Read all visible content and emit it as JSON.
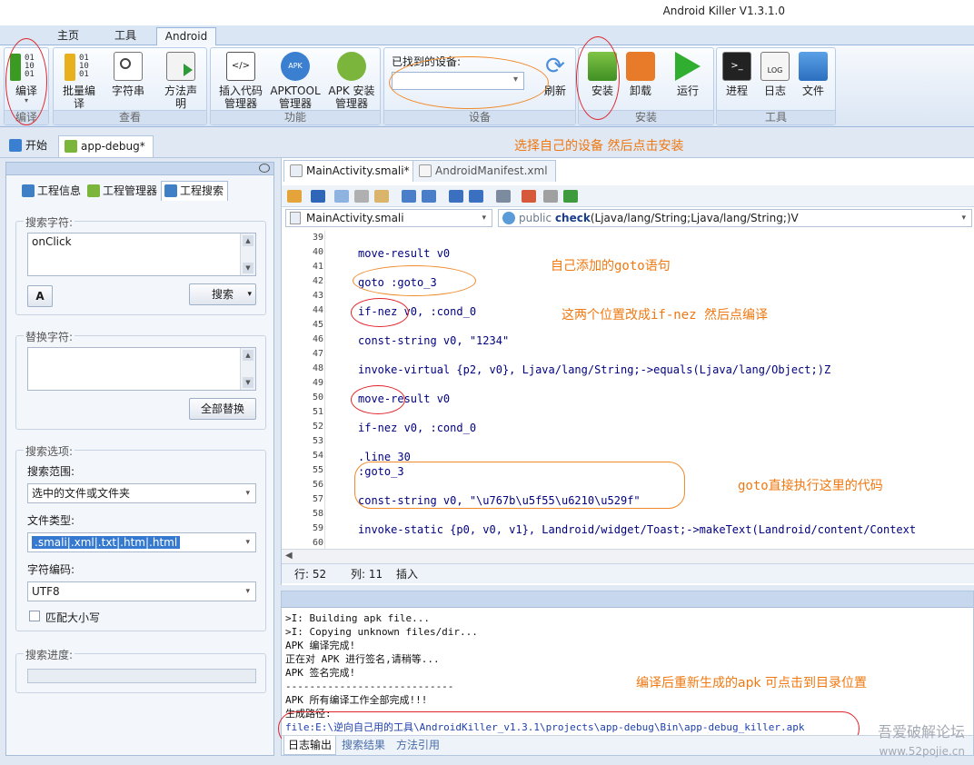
{
  "app": {
    "title": "Android Killer V1.3.1.0"
  },
  "ribbon": {
    "tabs": [
      {
        "label": "主页"
      },
      {
        "label": "工具"
      },
      {
        "label": "Android"
      }
    ],
    "groups": {
      "compile": {
        "label": "编译",
        "buttons": [
          {
            "label": "编译"
          }
        ]
      },
      "view": {
        "label": "查看",
        "buttons": [
          {
            "label": "批量编译"
          },
          {
            "label": "字符串"
          },
          {
            "label": "方法声明"
          }
        ]
      },
      "feature": {
        "label": "功能",
        "buttons": [
          {
            "label": "插入代码管理器"
          },
          {
            "label": "APKTOOL管理器"
          },
          {
            "label": "APK 安装管理器"
          }
        ]
      },
      "device": {
        "label": "设备",
        "found_label": "已找到的设备:",
        "refresh": "刷新"
      },
      "install": {
        "label": "安装",
        "buttons": [
          {
            "label": "安装"
          },
          {
            "label": "卸载"
          },
          {
            "label": "运行"
          }
        ]
      },
      "tools": {
        "label": "工具",
        "buttons": [
          {
            "label": "进程"
          },
          {
            "label": "日志"
          },
          {
            "label": "文件"
          }
        ]
      }
    }
  },
  "doc_tabs": {
    "start": "开始",
    "project": "app-debug*"
  },
  "annotations": {
    "select_device": "选择自己的设备 然后点击安装",
    "goto_added": "自己添加的goto语句",
    "change_ifnez": "这两个位置改成if-nez 然后点编译",
    "goto_exec": "goto直接执行这里的代码",
    "rebuilt_apk": "编译后重新生成的apk 可点击到目录位置"
  },
  "left_panel": {
    "tabs": [
      {
        "label": "工程信息"
      },
      {
        "label": "工程管理器"
      },
      {
        "label": "工程搜索"
      }
    ],
    "search": {
      "title": "搜索字符:",
      "value": "onClick",
      "button": "搜索",
      "font_icon": "A"
    },
    "replace": {
      "title": "替换字符:",
      "value": "",
      "button": "全部替换"
    },
    "options": {
      "title": "搜索选项:",
      "scope_label": "搜索范围:",
      "scope_value": "选中的文件或文件夹",
      "type_label": "文件类型:",
      "type_value": ".smali|.xml|.txt|.htm|.html",
      "enc_label": "字符编码:",
      "enc_value": "UTF8",
      "case_label": "匹配大小写"
    },
    "progress": {
      "title": "搜索进度:"
    }
  },
  "editor": {
    "tabs": [
      {
        "label": "MainActivity.smali*"
      },
      {
        "label": "AndroidManifest.xml"
      }
    ],
    "file_combo": "MainActivity.smali",
    "method_combo_kw": "public",
    "method_combo_name": "check",
    "method_combo_sig": "(Ljava/lang/String;Ljava/lang/String;)V",
    "lines": [
      {
        "n": "39",
        "text": ""
      },
      {
        "n": "40",
        "text": "move-result v0"
      },
      {
        "n": "41",
        "text": ""
      },
      {
        "n": "42",
        "text": "goto :goto_3"
      },
      {
        "n": "43",
        "text": ""
      },
      {
        "n": "44",
        "text": "if-nez v0, :cond_0"
      },
      {
        "n": "45",
        "text": ""
      },
      {
        "n": "46",
        "text": "const-string v0, \"1234\""
      },
      {
        "n": "47",
        "text": ""
      },
      {
        "n": "48",
        "text": "invoke-virtual {p2, v0}, Ljava/lang/String;->equals(Ljava/lang/Object;)Z"
      },
      {
        "n": "49",
        "text": ""
      },
      {
        "n": "50",
        "text": "move-result v0"
      },
      {
        "n": "51",
        "text": ""
      },
      {
        "n": "52",
        "text": "if-nez v0, :cond_0"
      },
      {
        "n": "53",
        "text": ""
      },
      {
        "n": "54",
        "text": ".line 30"
      },
      {
        "n": "55",
        "text": ":goto_3"
      },
      {
        "n": "56",
        "text": ""
      },
      {
        "n": "57",
        "text": "const-string v0, \"\\u767b\\u5f55\\u6210\\u529f\""
      },
      {
        "n": "58",
        "text": ""
      },
      {
        "n": "59",
        "text": "invoke-static {p0, v0, v1}, Landroid/widget/Toast;->makeText(Landroid/content/Context"
      },
      {
        "n": "60",
        "text": ""
      }
    ],
    "status": {
      "row": "行: 52",
      "col": "列: 11",
      "mode": "插入"
    }
  },
  "log": {
    "lines": [
      ">I: Building apk file...",
      ">I: Copying unknown files/dir...",
      "APK 编译完成!",
      "正在对 APK 进行签名,请稍等...",
      "APK 签名完成!",
      "----------------------------",
      "APK 所有编译工作全部完成!!!",
      "生成路径:"
    ],
    "path": "file:E:\\逆向自己用的工具\\AndroidKiller_v1.3.1\\projects\\app-debug\\Bin\\app-debug_killer.apk",
    "tabs": [
      {
        "label": "日志输出"
      },
      {
        "label": "搜索结果"
      },
      {
        "label": "方法引用"
      }
    ]
  },
  "watermark": {
    "cn": "吾爱破解论坛",
    "url": "www.52pojie.cn"
  }
}
